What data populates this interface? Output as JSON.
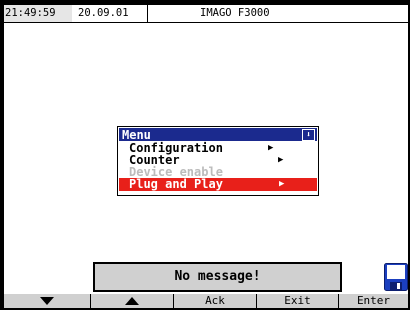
{
  "status_bar": {
    "time": "21:49:5",
    "time_seconds_digit": "9",
    "date": "20.09.01",
    "device_title": "IMAGO F3000"
  },
  "menu": {
    "title": "Menu",
    "items": [
      {
        "label": "Configuration",
        "has_submenu": true,
        "state": "normal"
      },
      {
        "label": "Counter",
        "has_submenu": true,
        "state": "normal"
      },
      {
        "label": "Device enable",
        "has_submenu": false,
        "state": "disabled"
      },
      {
        "label": "Plug and Play",
        "has_submenu": true,
        "state": "selected"
      }
    ],
    "submenu_arrow": "▶",
    "scroll_down_icon": "⬇"
  },
  "message": "No message!",
  "icons": [
    "down-arrow-icon",
    "up-arrow-icon",
    "floppy-disk-icon",
    "scroll-down-icon",
    "submenu-arrow-icon"
  ],
  "softkeys": {
    "down_icon": "down-arrow-icon",
    "up_icon": "up-arrow-icon",
    "ack": "Ack",
    "exit": "Exit",
    "enter": "Enter"
  },
  "colors": {
    "menu_header": "#1b2a8e",
    "selected_item": "#e8201a",
    "disabled_text": "#bcbcbc",
    "disk_icon": "#1b3fbf",
    "panel_gray": "#d0d0d0"
  }
}
